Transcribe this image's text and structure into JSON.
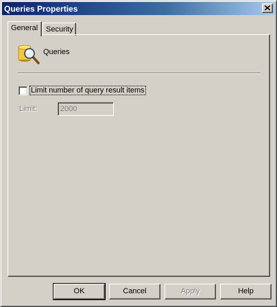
{
  "window": {
    "title": "Queries Properties"
  },
  "tabs": [
    {
      "label": "General",
      "active": true
    },
    {
      "label": "Security",
      "active": false
    }
  ],
  "general": {
    "object_name": "Queries",
    "object_icon": "saved-queries-icon",
    "limit_checkbox": {
      "label": "Limit number of query result items",
      "checked": false
    },
    "limit_field": {
      "label": "Limit:",
      "value": "2000",
      "disabled": true
    }
  },
  "buttons": {
    "ok": "OK",
    "cancel": "Cancel",
    "apply": "Apply",
    "help": "Help"
  },
  "colors": {
    "titlebar_start": "#0a246a",
    "titlebar_end": "#a6caf0",
    "face": "#d4d0c8",
    "disabled_text": "#808080"
  }
}
